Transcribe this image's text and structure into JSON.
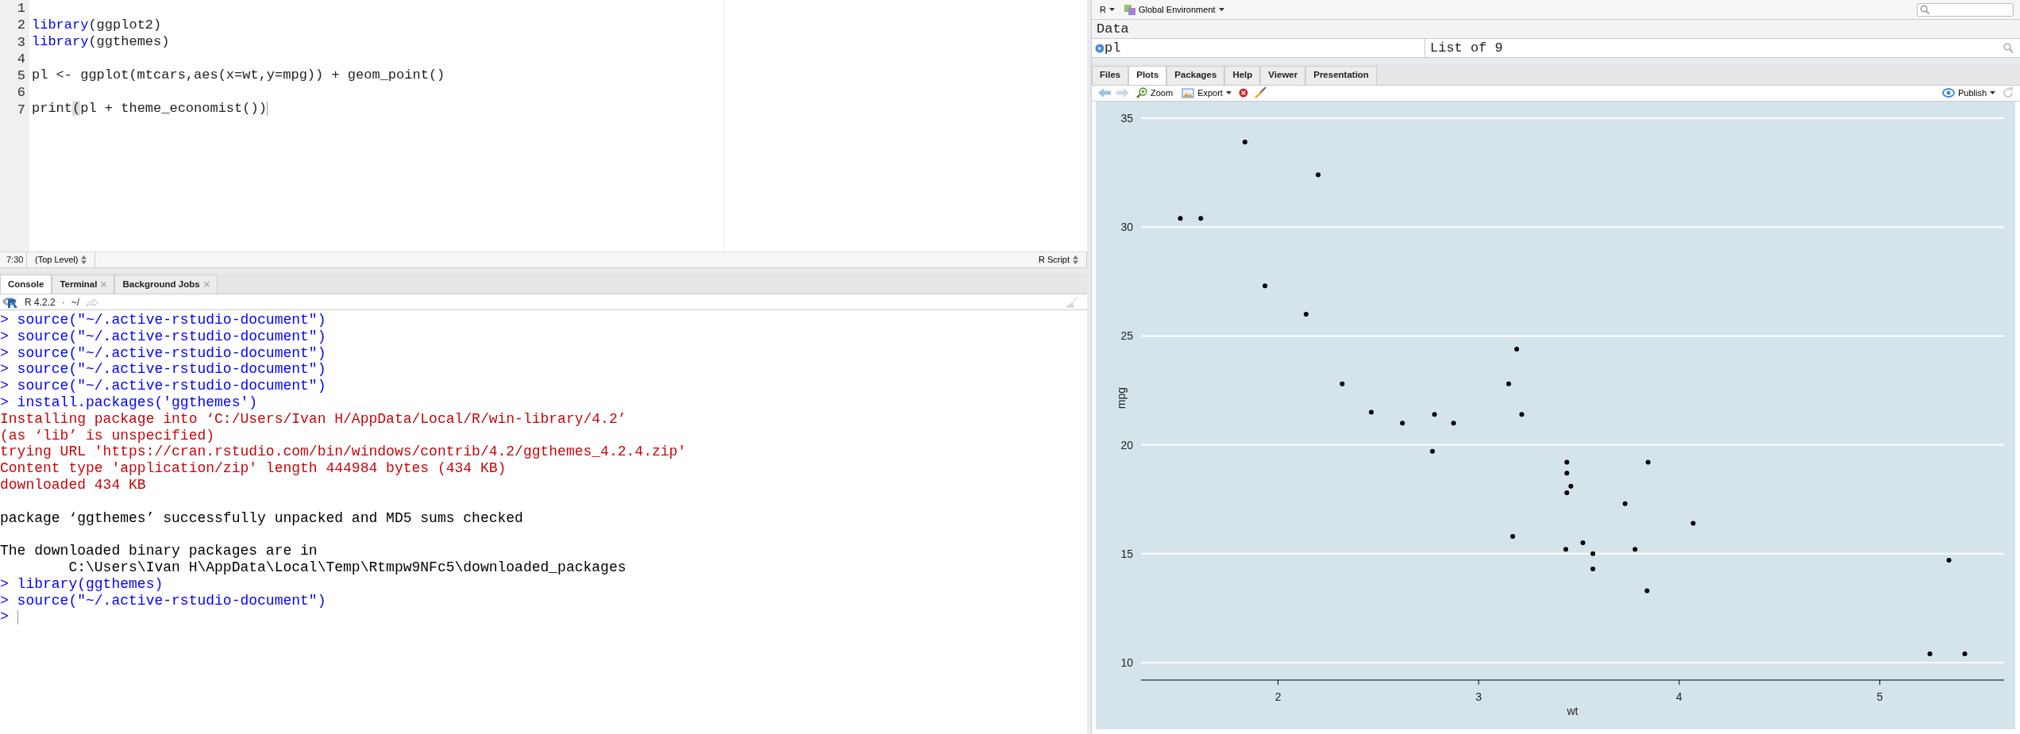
{
  "editor": {
    "lines": [
      {
        "number": "1"
      },
      {
        "number": "2",
        "segments": [
          {
            "text": "library",
            "kind": "keyword"
          },
          {
            "text": "(ggplot2)",
            "kind": "plain"
          }
        ]
      },
      {
        "number": "3",
        "segments": [
          {
            "text": "library",
            "kind": "keyword"
          },
          {
            "text": "(ggthemes)",
            "kind": "plain"
          }
        ]
      },
      {
        "number": "4"
      },
      {
        "number": "5",
        "segments": [
          {
            "text": "pl <- ggplot(mtcars,aes(x=wt,y=mpg)) + geom_point()",
            "kind": "plain"
          }
        ]
      },
      {
        "number": "6"
      },
      {
        "number": "7",
        "segments": [
          {
            "text": "print",
            "kind": "plain"
          },
          {
            "text": "(",
            "kind": "match"
          },
          {
            "text": "pl + theme_economist())",
            "kind": "plain"
          }
        ],
        "cursor": true
      }
    ],
    "status_bar": {
      "position": "7:30",
      "scope": "(Top Level)",
      "file_type": "R Script"
    }
  },
  "console": {
    "tabs": [
      {
        "label": "Console",
        "selected": true,
        "closable": false
      },
      {
        "label": "Terminal",
        "selected": false,
        "closable": true
      },
      {
        "label": "Background Jobs",
        "selected": false,
        "closable": true
      }
    ],
    "version": "R 4.2.2",
    "separator": "·",
    "path": "~/",
    "lines": [
      {
        "kind": "command",
        "text": "> source(\"~/.active-rstudio-document\")"
      },
      {
        "kind": "command",
        "text": "> source(\"~/.active-rstudio-document\")"
      },
      {
        "kind": "command",
        "text": "> source(\"~/.active-rstudio-document\")"
      },
      {
        "kind": "command",
        "text": "> source(\"~/.active-rstudio-document\")"
      },
      {
        "kind": "command",
        "text": "> source(\"~/.active-rstudio-document\")"
      },
      {
        "kind": "command",
        "text": "> install.packages('ggthemes')"
      },
      {
        "kind": "message",
        "text": "Installing package into ‘C:/Users/Ivan H/AppData/Local/R/win-library/4.2’"
      },
      {
        "kind": "message",
        "text": "(as ‘lib’ is unspecified)"
      },
      {
        "kind": "message",
        "text": "trying URL 'https://cran.rstudio.com/bin/windows/contrib/4.2/ggthemes_4.2.4.zip'"
      },
      {
        "kind": "message",
        "text": "Content type 'application/zip' length 444984 bytes (434 KB)"
      },
      {
        "kind": "message",
        "text": "downloaded 434 KB"
      },
      {
        "kind": "blank"
      },
      {
        "kind": "output",
        "text": "package ‘ggthemes’ successfully unpacked and MD5 sums checked"
      },
      {
        "kind": "blank"
      },
      {
        "kind": "output",
        "text": "The downloaded binary packages are in"
      },
      {
        "kind": "output",
        "text": "        C:\\Users\\Ivan H\\AppData\\Local\\Temp\\Rtmpw9NFc5\\downloaded_packages"
      },
      {
        "kind": "command",
        "text": "> library(ggthemes)"
      },
      {
        "kind": "command",
        "text": "> source(\"~/.active-rstudio-document\")"
      },
      {
        "kind": "command",
        "text": ">",
        "cursor": true
      }
    ]
  },
  "environment": {
    "language": "R",
    "scope": "Global Environment",
    "section": "Data",
    "rows": [
      {
        "name": "pl",
        "value": "List of  9"
      }
    ]
  },
  "files_pane": {
    "tabs": [
      {
        "label": "Files",
        "selected": false
      },
      {
        "label": "Plots",
        "selected": true
      },
      {
        "label": "Packages",
        "selected": false
      },
      {
        "label": "Help",
        "selected": false
      },
      {
        "label": "Viewer",
        "selected": false
      },
      {
        "label": "Presentation",
        "selected": false
      }
    ],
    "toolbar": {
      "zoom": "Zoom",
      "export": "Export",
      "publish": "Publish"
    },
    "plot": {
      "chart_data": {
        "type": "scatter",
        "xlabel": "wt",
        "ylabel": "mpg",
        "xlim": [
          1.317,
          5.62
        ],
        "ylim": [
          9.225,
          35.075
        ],
        "grid": true,
        "xticks": [
          2,
          3,
          4,
          5
        ],
        "yticks": [
          10,
          15,
          20,
          25,
          30,
          35
        ],
        "series": [
          {
            "color": "#000000",
            "x": [
              2.62,
              2.875,
              2.32,
              3.215,
              3.44,
              3.46,
              3.57,
              3.19,
              3.15,
              3.44,
              3.44,
              4.07,
              3.73,
              3.78,
              5.25,
              5.424,
              5.345,
              2.2,
              1.615,
              1.835,
              2.465,
              3.52,
              3.435,
              3.84,
              3.845,
              1.935,
              2.14,
              1.513,
              3.17,
              2.77,
              3.57,
              2.78
            ],
            "values": [
              21.0,
              21.0,
              22.8,
              21.4,
              18.7,
              18.1,
              14.3,
              24.4,
              22.8,
              19.2,
              17.8,
              16.4,
              17.3,
              15.2,
              10.4,
              10.4,
              14.7,
              32.4,
              30.4,
              33.9,
              21.5,
              15.5,
              15.2,
              13.3,
              19.2,
              27.3,
              26.0,
              30.4,
              15.8,
              19.7,
              15.0,
              21.4
            ]
          }
        ]
      }
    }
  }
}
